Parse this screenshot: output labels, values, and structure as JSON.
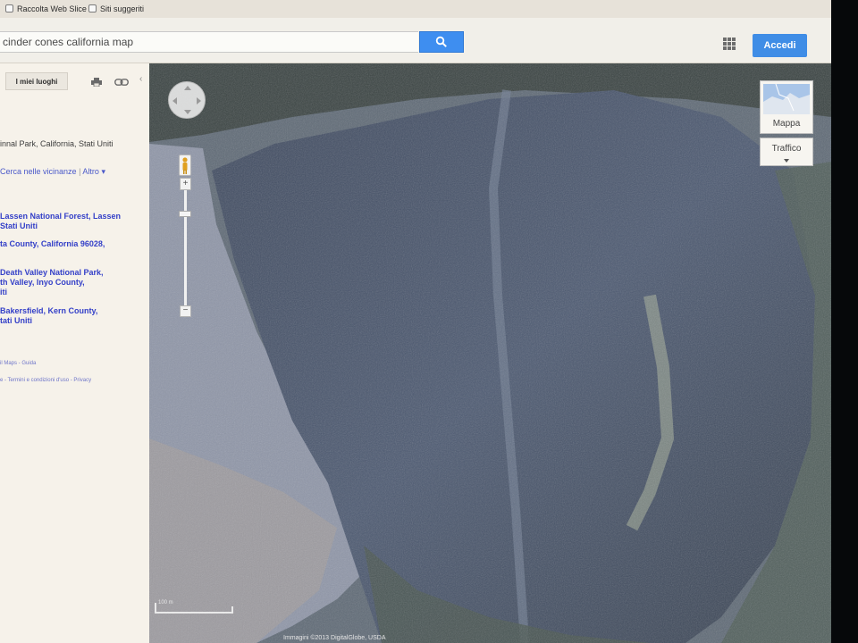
{
  "favorites_bar": {
    "items": [
      {
        "label": "Raccolta Web Slice",
        "icon": "web-slice-icon"
      },
      {
        "label": "Siti suggeriti",
        "icon": "suggested-sites-icon"
      }
    ]
  },
  "header": {
    "search_value": "cinder cones california map",
    "search_icon": "magnifier-icon",
    "apps_icon": "apps-grid-icon",
    "signin_label": "Accedi",
    "accent_color": "#3f8de6"
  },
  "left_panel": {
    "my_places_label": "I miei luoghi",
    "print_icon": "printer-icon",
    "link_icon": "link-icon",
    "collapse_icon": "chevron-left-icon",
    "place_line": "innal Park, California, Stati Uniti",
    "nearby_link": "Cerca nelle vicinanze",
    "more_link": "Altro",
    "results": [
      {
        "line1": "Lassen National Forest, Lassen",
        "line2": "Stati Uniti"
      },
      {
        "line1": "ta County, California 96028,"
      },
      {
        "line1": "Death Valley National Park,",
        "line2": "th Valley, Inyo County,",
        "line3": "iti"
      },
      {
        "line1": "Bakersfield, Kern County,",
        "line2": "tati Uniti"
      }
    ],
    "footer_line1": "il Maps - Guida",
    "footer_line2": "e - Termini e condizioni d'uso - Privacy"
  },
  "map": {
    "map_type_label": "Mappa",
    "traffic_label": "Traffico",
    "scale_label": "100 m",
    "attribution": "Immagini ©2013 DigitalGlobe, USDA"
  }
}
